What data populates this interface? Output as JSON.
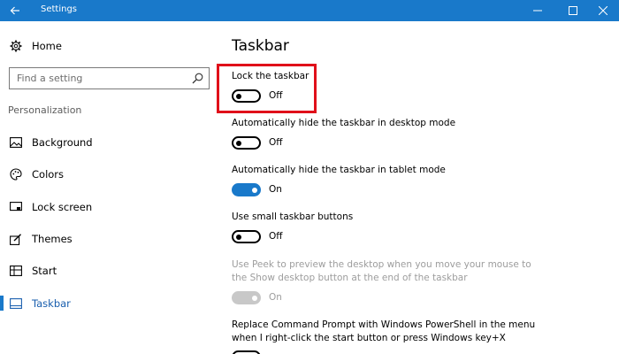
{
  "window": {
    "title": "Settings",
    "controls": [
      "minimize-icon",
      "maximize-icon",
      "close-icon"
    ],
    "accent": "#1979ca"
  },
  "sidebar": {
    "home_label": "Home",
    "search_placeholder": "Find a setting",
    "section_label": "Personalization",
    "items": [
      {
        "label": "Background",
        "icon": "picture-icon",
        "selected": false
      },
      {
        "label": "Colors",
        "icon": "palette-icon",
        "selected": false
      },
      {
        "label": "Lock screen",
        "icon": "lock-screen-icon",
        "selected": false
      },
      {
        "label": "Themes",
        "icon": "themes-icon",
        "selected": false
      },
      {
        "label": "Start",
        "icon": "start-icon",
        "selected": false
      },
      {
        "label": "Taskbar",
        "icon": "taskbar-icon",
        "selected": true
      }
    ]
  },
  "main": {
    "title": "Taskbar",
    "settings": [
      {
        "label": "Lock the taskbar",
        "state": "Off",
        "on": false,
        "enabled": true
      },
      {
        "label": "Automatically hide the taskbar in desktop mode",
        "state": "Off",
        "on": false,
        "enabled": true
      },
      {
        "label": "Automatically hide the taskbar in tablet mode",
        "state": "On",
        "on": true,
        "enabled": true
      },
      {
        "label": "Use small taskbar buttons",
        "state": "Off",
        "on": false,
        "enabled": true
      },
      {
        "label_lines": [
          "Use Peek to preview the desktop when you move your mouse to",
          "the Show desktop button at the end of the taskbar"
        ],
        "state": "On",
        "on": true,
        "enabled": false
      },
      {
        "label_lines": [
          "Replace Command Prompt with Windows PowerShell in the menu",
          "when I right-click the start button or press Windows key+X"
        ],
        "on": false,
        "enabled": true
      }
    ]
  }
}
